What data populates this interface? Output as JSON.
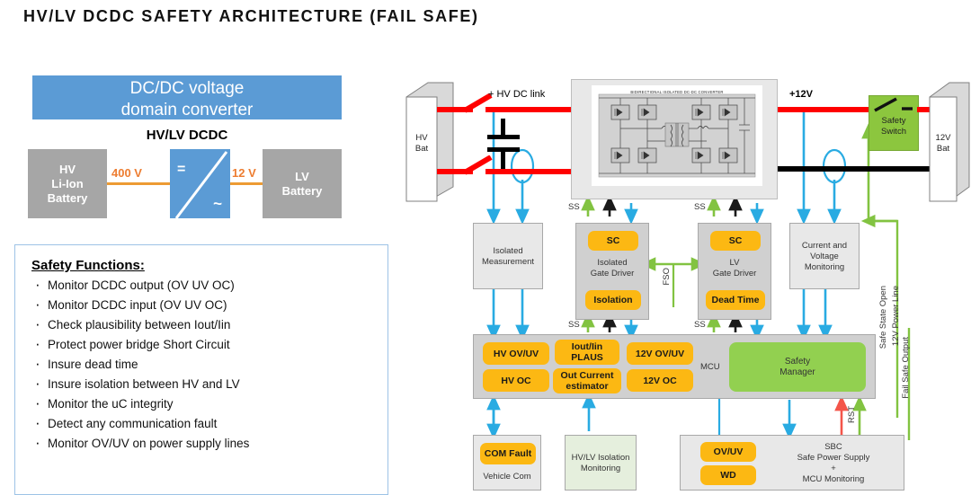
{
  "page": {
    "title": "HV/LV DCDC SAFETY ARCHITECTURE (FAIL SAFE)"
  },
  "overview": {
    "banner": "DC/DC voltage\ndomain converter",
    "banner_line1": "DC/DC voltage",
    "banner_line2": "domain converter",
    "converter_title": "HV/LV DCDC",
    "hv_battery": "HV\nLi-Ion\nBattery",
    "hv_battery_lines": [
      "HV",
      "Li-Ion",
      "Battery"
    ],
    "lv_battery_lines": [
      "LV",
      "Battery"
    ],
    "hv_voltage": "400 V",
    "lv_voltage": "12 V",
    "dc_symbol": "=",
    "ac_symbol": "~",
    "colors": {
      "banner_bg": "#5b9bd5",
      "battery_bg": "#a6a6a6",
      "wire": "#ed9b33"
    }
  },
  "safety_functions": {
    "title": "Safety Functions:",
    "items": [
      "Monitor DCDC output (OV UV OC)",
      "Monitor DCDC input (OV UV OC)",
      "Check plausibility between Iout/Iin",
      "Protect power bridge Short Circuit",
      "Insure dead time",
      "Insure isolation between HV and LV",
      "Monitor the uC integrity",
      "Detect any communication fault",
      "Monitor OV/UV on power supply lines"
    ]
  },
  "architecture": {
    "hv_battery": {
      "line1": "HV",
      "line2": "Bat"
    },
    "lv_battery": {
      "line1": "12V",
      "line2": "Bat"
    },
    "hv_dc_link_label": "+ HV DC link",
    "lv_rail_label": "+12V",
    "safety_switch": {
      "line1": "Safety",
      "line2": "Switch"
    },
    "converter_schematic_title": "BIDIRECTIONAL ISOLATED DC-DC CONVERTER",
    "blocks": {
      "isolated_measurement": {
        "line1": "Isolated",
        "line2": "Measurement"
      },
      "isolated_gate_driver": {
        "line1": "Isolated",
        "line2": "Gate Driver",
        "pill_top": "SC",
        "pill_bottom": "Isolation"
      },
      "lv_gate_driver": {
        "line1": "LV",
        "line2": "Gate Driver",
        "pill_top": "SC",
        "pill_bottom": "Dead Time"
      },
      "current_voltage_monitoring": {
        "line1": "Current and",
        "line2": "Voltage",
        "line3": "Monitoring"
      },
      "mcu": {
        "label": "MCU",
        "pills": [
          "HV OV/UV",
          "Iout/Iin\nPLAUS",
          "12V OV/UV",
          "HV OC",
          "Out Current\nestimator",
          "12V OC"
        ],
        "pill_hv_ovuv": "HV OV/UV",
        "pill_hv_oc": "HV OC",
        "pill_iout_iin_l1": "Iout/Iin",
        "pill_iout_iin_l2": "PLAUS",
        "pill_out_current_l1": "Out Current",
        "pill_out_current_l2": "estimator",
        "pill_12v_ovuv": "12V OV/UV",
        "pill_12v_oc": "12V OC",
        "safety_manager_l1": "Safety",
        "safety_manager_l2": "Manager"
      },
      "vehicle_com": {
        "pill": "COM Fault",
        "label": "Vehicle Com"
      },
      "hv_lv_isolation_monitoring": {
        "line1": "HV/LV Isolation",
        "line2": "Monitoring"
      },
      "sbc": {
        "pill_top": "OV/UV",
        "pill_bottom": "WD",
        "line1": "SBC",
        "line2": "Safe Power Supply",
        "line3": "+",
        "line4": "MCU Monitoring"
      }
    },
    "signal_labels": {
      "ss_1": "SS",
      "ss_2": "SS",
      "ss_3": "SS",
      "ss_4": "SS",
      "fso": "FSO",
      "rst": "RST",
      "safe_state_open": "Safe State Open",
      "power_line_12v": "12V Power Line",
      "fail_safe_output": "Fail Safe Output"
    },
    "colors": {
      "hv_rail": "#ff0000",
      "lv_return": "#000000",
      "measure_signal": "#29ABE2",
      "safety_signal": "#82c341",
      "reset_signal": "#f4554a",
      "pill": "#fcb813",
      "safety_manager": "#92d050",
      "safety_switch": "#8cc63e"
    }
  }
}
